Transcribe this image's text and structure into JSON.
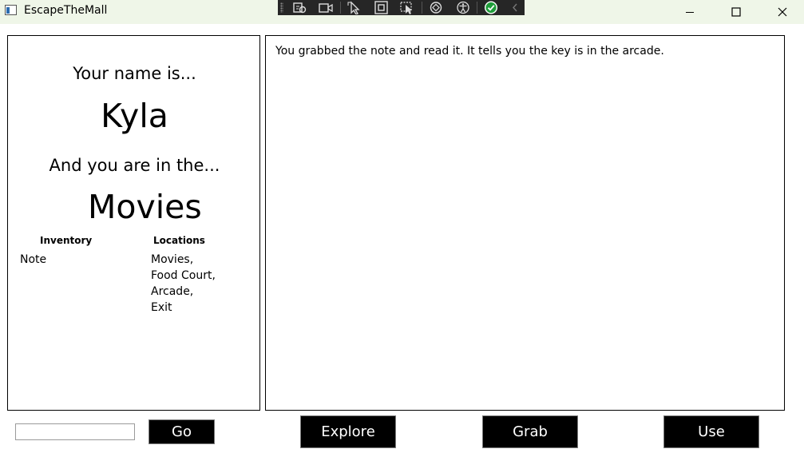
{
  "window": {
    "title": "EscapeTheMall"
  },
  "left_panel": {
    "name_intro": "Your name is...",
    "player_name": "Kyla",
    "location_intro": "And you are in the...",
    "current_location": "Movies",
    "inventory_header": "Inventory",
    "locations_header": "Locations",
    "inventory": [
      "Note"
    ],
    "locations": [
      "Movies,",
      "Food Court,",
      "Arcade,",
      "Exit"
    ]
  },
  "message_panel": {
    "text": "You grabbed the note and read it. It tells you the key is in the arcade."
  },
  "controls": {
    "command_value": "",
    "go_label": "Go",
    "explore_label": "Explore",
    "grab_label": "Grab",
    "use_label": "Use"
  },
  "debug_toolbar": {
    "icons": [
      "select-element-icon",
      "record-icon",
      "pointer-icon",
      "layout-adorner-icon",
      "track-focus-icon",
      "binding-failures-icon",
      "accessibility-icon",
      "checkmark-icon",
      "collapse-icon"
    ]
  }
}
